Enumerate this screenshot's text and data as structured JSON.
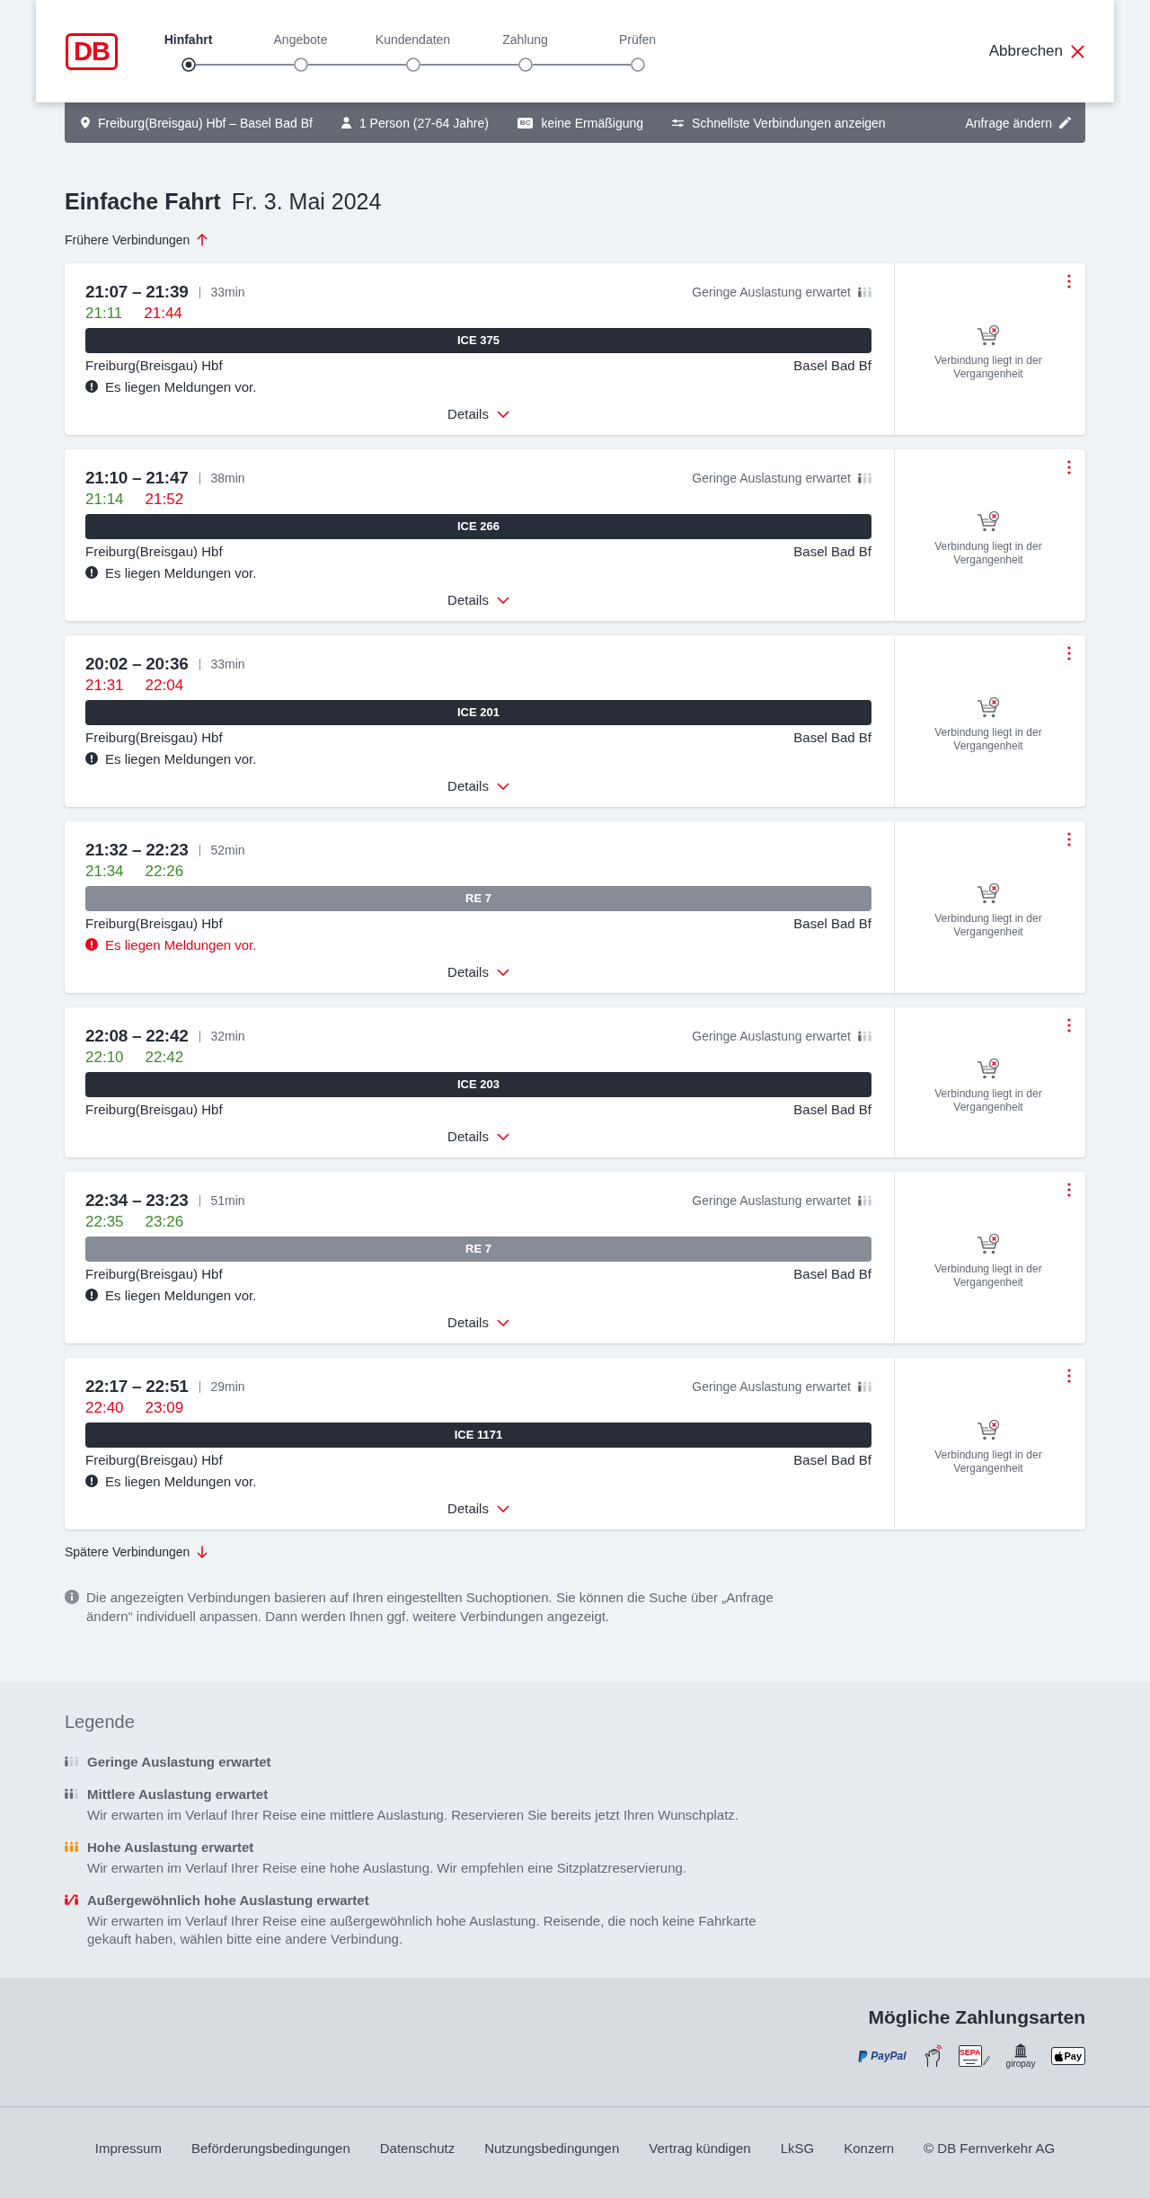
{
  "header": {
    "logo": "DB",
    "steps": [
      {
        "label": "Hinfahrt",
        "selected": true
      },
      {
        "label": "Angebote",
        "selected": false
      },
      {
        "label": "Kundendaten",
        "selected": false
      },
      {
        "label": "Zahlung",
        "selected": false
      },
      {
        "label": "Prüfen",
        "selected": false
      }
    ],
    "cancel": "Abbrechen"
  },
  "search_summary": {
    "route": "Freiburg(Breisgau) Hbf – Basel Bad Bf",
    "travellers": "1 Person (27-64 Jahre)",
    "discount_badge": "BC",
    "discount": "keine Ermäßigung",
    "option": "Schnellste Verbindungen anzeigen",
    "edit": "Anfrage ändern"
  },
  "title": {
    "trip": "Einfache Fahrt",
    "date": "Fr. 3. Mai 2024"
  },
  "earlier": "Frühere Verbindungen",
  "connections": [
    {
      "times": "21:07 – 21:39",
      "duration": "33min",
      "occupancy": {
        "kind": "low",
        "label": "Geringe Auslastung erwartet"
      },
      "realtime": [
        {
          "time": "21:11",
          "delayed": false
        },
        {
          "time": "21:44",
          "delayed": true
        }
      ],
      "train": {
        "kind": "ice",
        "label": "ICE 375"
      },
      "from": "Freiburg(Breisgau) Hbf",
      "to": "Basel Bad Bf",
      "message": {
        "text": "Es liegen Meldungen vor.",
        "urgent": false
      },
      "details": "Details",
      "status": "Verbindung liegt in der Vergangenheit"
    },
    {
      "times": "21:10 – 21:47",
      "duration": "38min",
      "occupancy": {
        "kind": "low",
        "label": "Geringe Auslastung erwartet"
      },
      "realtime": [
        {
          "time": "21:14",
          "delayed": false
        },
        {
          "time": "21:52",
          "delayed": true
        }
      ],
      "train": {
        "kind": "ice",
        "label": "ICE 266"
      },
      "from": "Freiburg(Breisgau) Hbf",
      "to": "Basel Bad Bf",
      "message": {
        "text": "Es liegen Meldungen vor.",
        "urgent": false
      },
      "details": "Details",
      "status": "Verbindung liegt in der Vergangenheit"
    },
    {
      "times": "20:02 – 20:36",
      "duration": "33min",
      "realtime": [
        {
          "time": "21:31",
          "delayed": true
        },
        {
          "time": "22:04",
          "delayed": true
        }
      ],
      "train": {
        "kind": "ice",
        "label": "ICE 201"
      },
      "from": "Freiburg(Breisgau) Hbf",
      "to": "Basel Bad Bf",
      "message": {
        "text": "Es liegen Meldungen vor.",
        "urgent": false
      },
      "details": "Details",
      "status": "Verbindung liegt in der Vergangenheit"
    },
    {
      "times": "21:32 – 22:23",
      "duration": "52min",
      "realtime": [
        {
          "time": "21:34",
          "delayed": false
        },
        {
          "time": "22:26",
          "delayed": false
        }
      ],
      "train": {
        "kind": "regional",
        "label": "RE 7"
      },
      "from": "Freiburg(Breisgau) Hbf",
      "to": "Basel Bad Bf",
      "message": {
        "text": "Es liegen Meldungen vor.",
        "urgent": true
      },
      "details": "Details",
      "status": "Verbindung liegt in der Vergangenheit"
    },
    {
      "times": "22:08 – 22:42",
      "duration": "32min",
      "occupancy": {
        "kind": "low",
        "label": "Geringe Auslastung erwartet"
      },
      "realtime": [
        {
          "time": "22:10",
          "delayed": false
        },
        {
          "time": "22:42",
          "delayed": false
        }
      ],
      "train": {
        "kind": "ice",
        "label": "ICE 203"
      },
      "from": "Freiburg(Breisgau) Hbf",
      "to": "Basel Bad Bf",
      "details": "Details",
      "status": "Verbindung liegt in der Vergangenheit"
    },
    {
      "times": "22:34 – 23:23",
      "duration": "51min",
      "occupancy": {
        "kind": "low",
        "label": "Geringe Auslastung erwartet"
      },
      "realtime": [
        {
          "time": "22:35",
          "delayed": false
        },
        {
          "time": "23:26",
          "delayed": false
        }
      ],
      "train": {
        "kind": "regional",
        "label": "RE 7"
      },
      "from": "Freiburg(Breisgau) Hbf",
      "to": "Basel Bad Bf",
      "message": {
        "text": "Es liegen Meldungen vor.",
        "urgent": false
      },
      "details": "Details",
      "status": "Verbindung liegt in der Vergangenheit"
    },
    {
      "times": "22:17 – 22:51",
      "duration": "29min",
      "occupancy": {
        "kind": "low",
        "label": "Geringe Auslastung erwartet"
      },
      "realtime": [
        {
          "time": "22:40",
          "delayed": true
        },
        {
          "time": "23:09",
          "delayed": true
        }
      ],
      "train": {
        "kind": "ice",
        "label": "ICE 1171"
      },
      "from": "Freiburg(Breisgau) Hbf",
      "to": "Basel Bad Bf",
      "message": {
        "text": "Es liegen Meldungen vor.",
        "urgent": false
      },
      "details": "Details",
      "status": "Verbindung liegt in der Vergangenheit"
    }
  ],
  "later": "Spätere Verbindungen",
  "info": "Die angezeigten Verbindungen basieren auf Ihren eingestellten Suchoptionen. Sie können die Suche über „Anfrage ändern“ individuell anpassen. Dann werden Ihnen ggf. weitere Verbindungen angezeigt.",
  "legend": {
    "title": "Legende",
    "items": [
      {
        "kind": "low",
        "label": "Geringe Auslastung erwartet"
      },
      {
        "kind": "medium",
        "label": "Mittlere Auslastung erwartet",
        "description": "Wir erwarten im Verlauf Ihrer Reise eine mittlere Auslastung. Reservieren Sie bereits jetzt Ihren Wunschplatz."
      },
      {
        "kind": "high",
        "label": "Hohe Auslastung erwartet",
        "description": "Wir erwarten im Verlauf Ihrer Reise eine hohe Auslastung. Wir empfehlen eine Sitzplatzreservierung."
      },
      {
        "kind": "exceptional",
        "label": "Außergewöhnlich hohe Auslastung erwartet",
        "description": "Wir erwarten im Verlauf Ihrer Reise eine außergewöhnlich hohe Auslastung. Reisende, die noch keine Fahrkarte gekauft haben, wählen bitte eine andere Verbindung."
      }
    ]
  },
  "payment": {
    "title": "Mögliche Zahlungsarten",
    "methods": [
      {
        "kind": "paypal",
        "label": "PayPal"
      },
      {
        "kind": "contactless"
      },
      {
        "kind": "sepa",
        "label": "SEPA"
      },
      {
        "kind": "giropay",
        "label": "giropay"
      },
      {
        "kind": "applepay",
        "label": "Pay"
      }
    ]
  },
  "footer_links": [
    "Impressum",
    "Beförderungsbedingungen",
    "Datenschutz",
    "Nutzungsbedingungen",
    "Vertrag kündigen",
    "LkSG",
    "Konzern"
  ],
  "copyright": "© DB Fernverkehr AG"
}
